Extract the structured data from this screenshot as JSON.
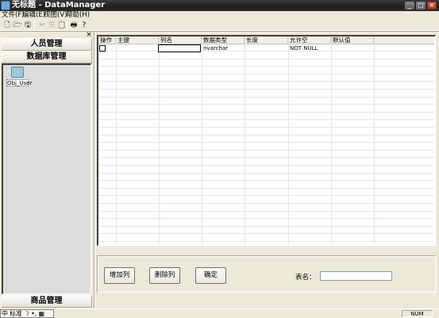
{
  "window": {
    "title": "无标题 - DataManager",
    "controls": {
      "minimize": "_",
      "maximize": "□",
      "close": "×"
    }
  },
  "menu": [
    "文件(F)",
    "编辑(E)",
    "视图(V)",
    "帮助(H)"
  ],
  "toolbar": {
    "icons": [
      "new-file-icon",
      "open-folder-icon",
      "save-icon",
      "cut-icon",
      "copy-icon",
      "paste-icon",
      "print-icon",
      "help-icon"
    ]
  },
  "sidebar": {
    "close_glyph": "×",
    "sections": [
      "人员管理",
      "数据库管理",
      "商品管理"
    ],
    "objects": [
      {
        "label": "Obj_User",
        "icon": "database-object-icon"
      }
    ]
  },
  "grid": {
    "columns": [
      "操作",
      "主键",
      "列名",
      "数据类型",
      "长度",
      "允许空",
      "默认值"
    ],
    "rows": [
      {
        "action": "",
        "primary_key": "",
        "name": "",
        "type": "nvarchar",
        "length": "",
        "nullable": "NOT NULL",
        "default": ""
      }
    ]
  },
  "form": {
    "buttons": {
      "add": "增加列",
      "delete": "删除列",
      "confirm": "确定"
    },
    "table_name_label": "表名：",
    "table_name_value": ""
  },
  "status": {
    "num": "NUM",
    "ime": [
      "中",
      "标准",
      "☽",
      "•,",
      "▦"
    ]
  }
}
